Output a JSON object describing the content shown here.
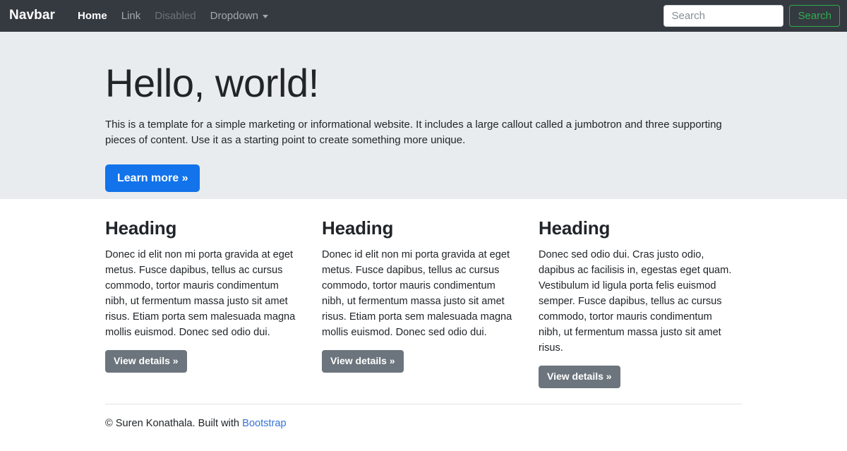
{
  "navbar": {
    "brand": "Navbar",
    "items": [
      {
        "label": "Home",
        "state": "active"
      },
      {
        "label": "Link",
        "state": "default"
      },
      {
        "label": "Disabled",
        "state": "disabled"
      },
      {
        "label": "Dropdown",
        "state": "dropdown"
      }
    ],
    "search": {
      "placeholder": "Search",
      "value": "",
      "button_label": "Search"
    },
    "colors": {
      "background": "#343a40",
      "brand_text": "#ffffff",
      "search_button_outline": "#2eae4e"
    }
  },
  "jumbotron": {
    "title": "Hello, world!",
    "lead": "This is a template for a simple marketing or informational website. It includes a large callout called a jumbotron and three supporting pieces of content. Use it as a starting point to create something more unique.",
    "cta_label": "Learn more »",
    "colors": {
      "background": "#e9ecef",
      "cta_background": "#1273eb"
    }
  },
  "content": {
    "columns": [
      {
        "heading": "Heading",
        "body": "Donec id elit non mi porta gravida at eget metus. Fusce dapibus, tellus ac cursus commodo, tortor mauris condimentum nibh, ut fermentum massa justo sit amet risus. Etiam porta sem malesuada magna mollis euismod. Donec sed odio dui.",
        "button_label": "View details »"
      },
      {
        "heading": "Heading",
        "body": "Donec id elit non mi porta gravida at eget metus. Fusce dapibus, tellus ac cursus commodo, tortor mauris condimentum nibh, ut fermentum massa justo sit amet risus. Etiam porta sem malesuada magna mollis euismod. Donec sed odio dui.",
        "button_label": "View details »"
      },
      {
        "heading": "Heading",
        "body": "Donec sed odio dui. Cras justo odio, dapibus ac facilisis in, egestas eget quam. Vestibulum id ligula porta felis euismod semper. Fusce dapibus, tellus ac cursus commodo, tortor mauris condimentum nibh, ut fermentum massa justo sit amet risus.",
        "button_label": "View details »"
      }
    ],
    "button_color": "#6c757d"
  },
  "footer": {
    "text_prefix": "© Suren Konathala. Built with ",
    "link_label": "Bootstrap",
    "link_color": "#3572d6"
  }
}
